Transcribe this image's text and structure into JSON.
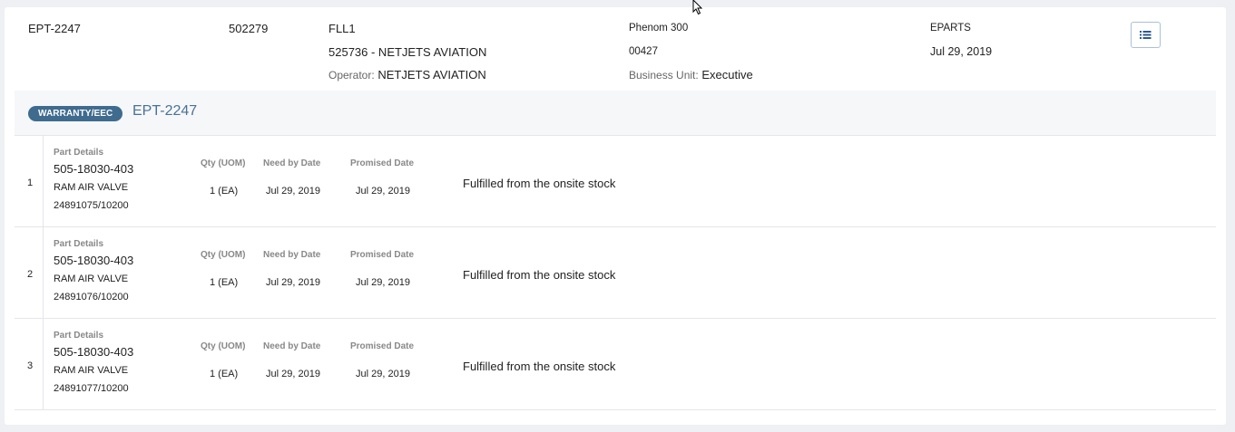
{
  "header": {
    "order_id": "EPT-2247",
    "account_no": "502279",
    "station": "FLL1",
    "customer": "525736 - NETJETS AVIATION",
    "operator_label": "Operator:",
    "operator_value": "NETJETS AVIATION",
    "aircraft_model": "Phenom 300",
    "serial": "00427",
    "business_unit_label": "Business Unit:",
    "business_unit_value": "Executive",
    "source": "EPARTS",
    "date": "Jul 29, 2019",
    "menu_icon": "list-icon"
  },
  "section": {
    "badge": "WARRANTY/EEC",
    "title": "EPT-2247"
  },
  "columns": {
    "part_details": "Part Details",
    "qty": "Qty (UOM)",
    "need_by": "Need by Date",
    "promised": "Promised Date"
  },
  "lines": [
    {
      "index": "1",
      "part_number": "505-18030-403",
      "description": "RAM AIR VALVE",
      "reference": "24891075/10200",
      "qty": "1 (EA)",
      "need_by": "Jul 29, 2019",
      "promised": "Jul 29, 2019",
      "status": "Fulfilled from the onsite stock"
    },
    {
      "index": "2",
      "part_number": "505-18030-403",
      "description": "RAM AIR VALVE",
      "reference": "24891076/10200",
      "qty": "1 (EA)",
      "need_by": "Jul 29, 2019",
      "promised": "Jul 29, 2019",
      "status": "Fulfilled from the onsite stock"
    },
    {
      "index": "3",
      "part_number": "505-18030-403",
      "description": "RAM AIR VALVE",
      "reference": "24891077/10200",
      "qty": "1 (EA)",
      "need_by": "Jul 29, 2019",
      "promised": "Jul 29, 2019",
      "status": "Fulfilled from the onsite stock"
    }
  ],
  "colors": {
    "badge_bg": "#3f6b8e",
    "title_blue": "#4a7296",
    "band_bg": "#f6f7f9"
  }
}
